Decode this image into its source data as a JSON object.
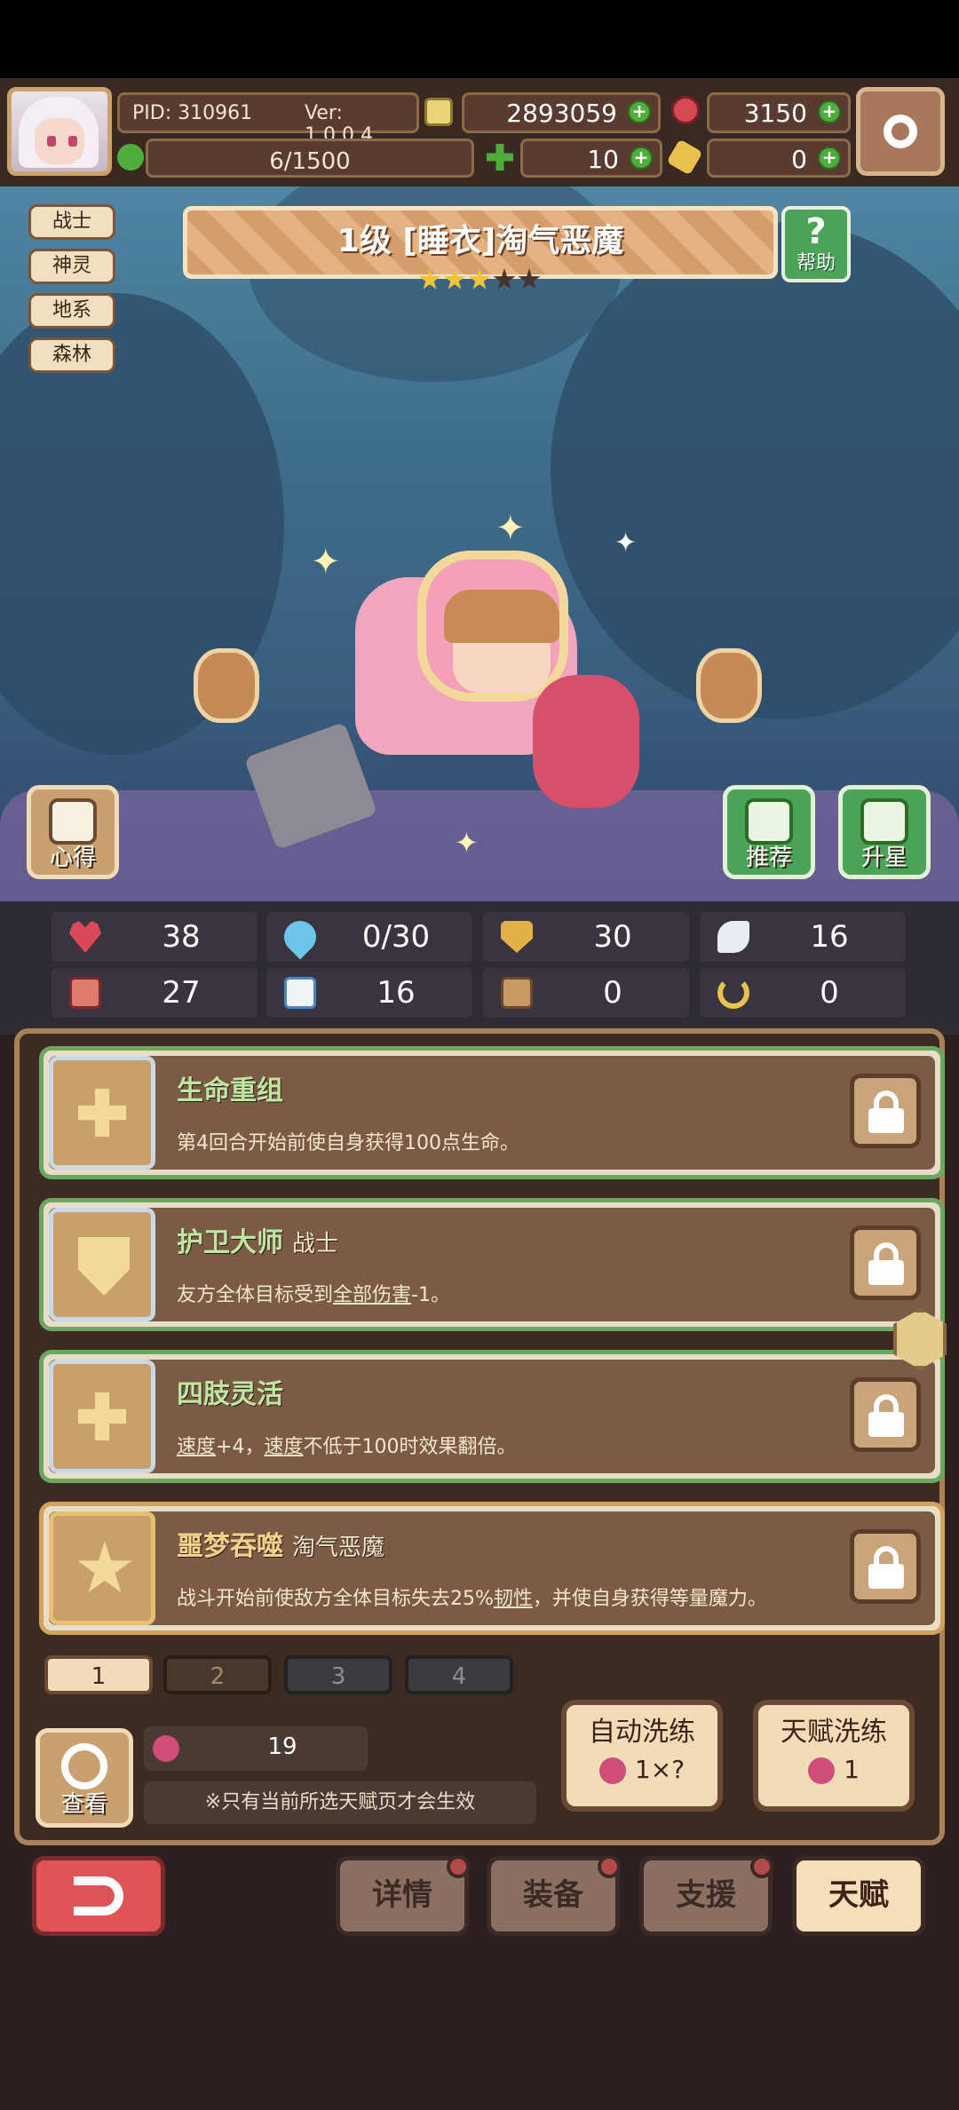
{
  "header": {
    "pid": "PID: 310961",
    "version": "Ver: 1.0.0.4",
    "gold": "2893059",
    "gems": "3150",
    "stamina": "6/1500",
    "clover": "10",
    "key": "0"
  },
  "hero": {
    "tags": [
      "战士",
      "神灵",
      "地系",
      "森林"
    ],
    "title": "1级  [睡衣]淘气恶魔",
    "stars_on": 3,
    "stars_total": 5,
    "help_label": "帮助",
    "insight_label": "心得",
    "recommend_label": "推荐",
    "upstar_label": "升星"
  },
  "stats": {
    "hp": "38",
    "mana": "0/30",
    "defense": "30",
    "speed": "16",
    "attack": "27",
    "magic": "16",
    "bed": "0",
    "toughness": "0"
  },
  "talents": [
    {
      "name": "生命重组",
      "type": "",
      "desc": "第4回合开始前使自身获得100点生命。"
    },
    {
      "name": "护卫大师",
      "type": "战士",
      "desc_a": "友方全体目标受到",
      "desc_u": "全部伤害",
      "desc_b": "-1。"
    },
    {
      "name": "四肢灵活",
      "type": "",
      "desc_u1": "速度",
      "desc_m": "+4，",
      "desc_u2": "速度",
      "desc_e": "不低于100时效果翻倍。"
    },
    {
      "name": "噩梦吞噬",
      "type": "淘气恶魔",
      "desc_a": "战斗开始前使敌方全体目标失去25%",
      "desc_u": "韧性",
      "desc_b": "，并使自身获得等量魔力。"
    }
  ],
  "pages": [
    "1",
    "2",
    "3",
    "4"
  ],
  "reroll": {
    "berry_count": "19",
    "note": "※只有当前所选天赋页才会生效",
    "view_label": "查看",
    "auto_label": "自动洗练",
    "auto_cost": "1×?",
    "talent_label": "天赋洗练",
    "talent_cost": "1"
  },
  "nav": {
    "details": "详情",
    "equip": "装备",
    "support": "支援",
    "talent": "天赋"
  },
  "colors": {
    "accent_green": "#4aa458",
    "panel_brown": "#3d2a22",
    "gold_border": "#d1a35e"
  }
}
